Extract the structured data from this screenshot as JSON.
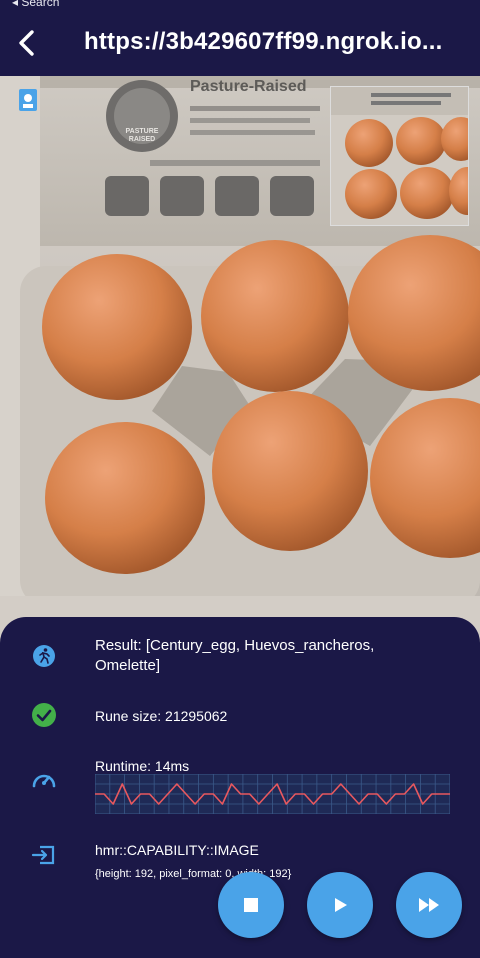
{
  "status": {
    "back_label": "◂ Search"
  },
  "header": {
    "url": "https://3b429607ff99.ngrok.io..."
  },
  "camera": {
    "carton_text": "Pasture-Raised",
    "seal_text": "PASTURE RAISED"
  },
  "result": {
    "line1": "Result: [Century_egg, Huevos_rancheros,",
    "line2": "Omelette]"
  },
  "rune": {
    "label": "Rune size: 21295062"
  },
  "runtime": {
    "label": "Runtime: 14ms",
    "series": [
      14,
      14,
      13,
      15,
      13,
      14,
      14,
      13,
      14,
      15,
      14,
      13,
      14,
      14,
      13,
      15,
      14,
      14,
      13,
      14,
      15,
      13,
      14,
      14,
      13,
      14,
      14,
      15,
      14,
      13,
      14,
      14,
      13,
      14,
      14,
      15,
      13,
      14,
      14,
      14
    ]
  },
  "capability": {
    "label": "hmr::CAPABILITY::IMAGE",
    "details": "{height: 192, pixel_format: 0, width: 192}"
  },
  "colors": {
    "background": "#1b1847",
    "accent": "#4aa3e8",
    "success": "#43b049",
    "line": "#e8585e"
  },
  "icons": [
    "chevron-left-icon",
    "camera-icon",
    "run-icon",
    "check-circle-icon",
    "speedometer-icon",
    "login-icon",
    "stop-icon",
    "play-icon",
    "fast-forward-icon"
  ]
}
